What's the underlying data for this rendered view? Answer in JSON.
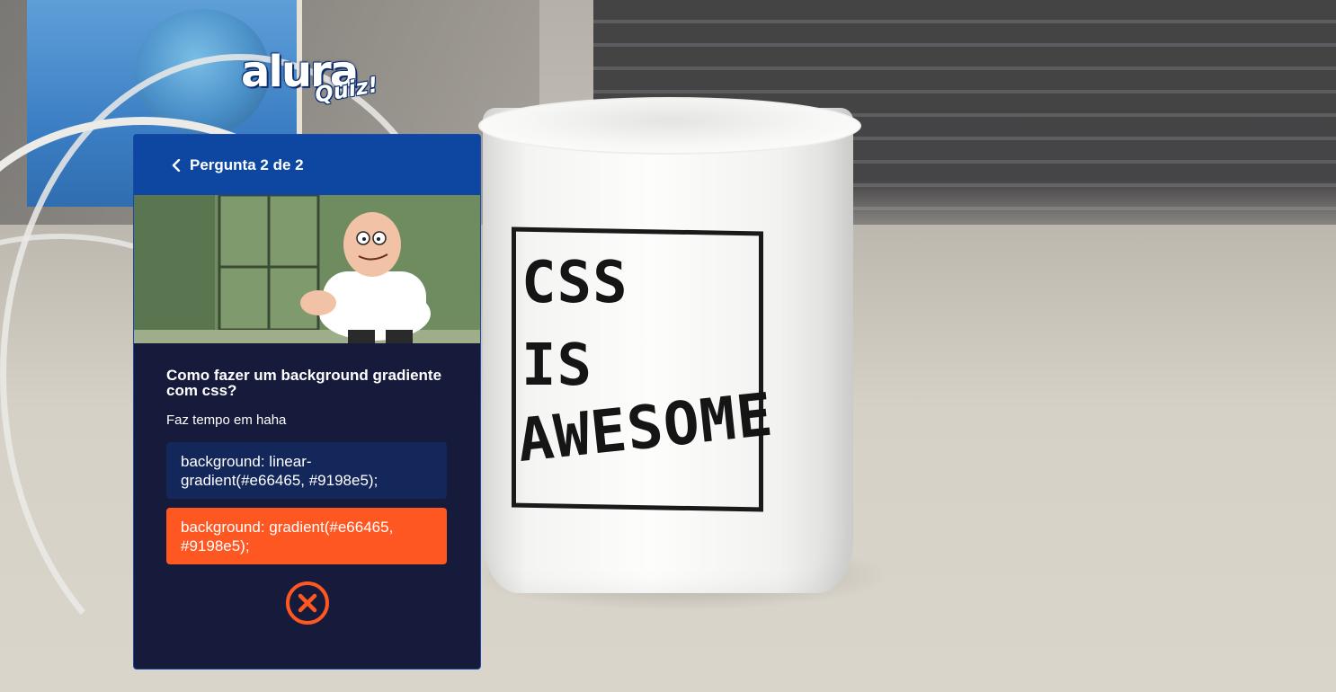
{
  "logo": {
    "brand": "alura",
    "sub": "Quiz!"
  },
  "card": {
    "header_title": "Pergunta 2 de 2",
    "question_title": "Como fazer um background gradiente com css?",
    "question_description": "Faz tempo em haha",
    "answers": [
      {
        "label": "background: linear-gradient(#e66465, #9198e5);",
        "state": "neutral"
      },
      {
        "label": "background: gradient(#e66465, #9198e5);",
        "state": "selected-wrong"
      }
    ],
    "result": "wrong"
  },
  "background": {
    "mug_text": [
      "CSS",
      "IS",
      "AWESOME"
    ]
  },
  "colors": {
    "primary": "#0d47a1",
    "main_bg": "#161a3b",
    "contrast_text": "#ffffff",
    "wrong": "#ff5722",
    "answer_bg": "#13275b"
  },
  "icons": {
    "back": "chevron-left-icon",
    "result": "close-circle-icon"
  }
}
